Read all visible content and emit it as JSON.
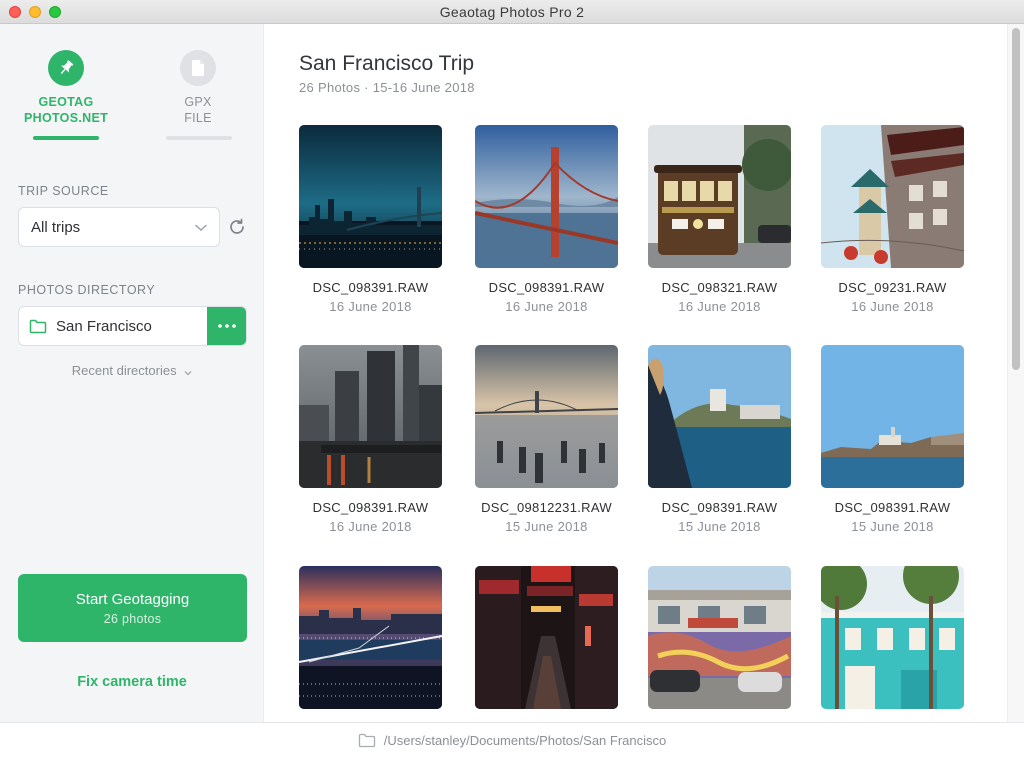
{
  "window": {
    "title": "Geaotag Photos Pro 2"
  },
  "sidebar": {
    "tabs": [
      {
        "label": "GEOTAG\nPHOTOS.NET",
        "icon": "pushpin-icon",
        "active": true
      },
      {
        "label": "GPX\nFILE",
        "icon": "file-icon",
        "active": false
      }
    ],
    "trip_source": {
      "label": "TRIP SOURCE",
      "value": "All trips"
    },
    "photos_directory": {
      "label": "PHOTOS DIRECTORY",
      "value": "San Francisco"
    },
    "recent_directories": "Recent directories",
    "start_button": {
      "title": "Start Geotagging",
      "subtitle": "26 photos"
    },
    "fix_camera_time": "Fix camera time"
  },
  "album": {
    "title": "San Francisco Trip",
    "meta": "26 Photos · 15-16 June 2018",
    "photos": [
      {
        "name": "DSC_098391.RAW",
        "date": "16 June 2018"
      },
      {
        "name": "DSC_098391.RAW",
        "date": "16 June 2018"
      },
      {
        "name": "DSC_098321.RAW",
        "date": "16 June 2018"
      },
      {
        "name": "DSC_09231.RAW",
        "date": "16 June 2018"
      },
      {
        "name": "DSC_098391.RAW",
        "date": "16 June 2018"
      },
      {
        "name": "DSC_09812231.RAW",
        "date": "15 June 2018"
      },
      {
        "name": "DSC_098391.RAW",
        "date": "15 June 2018"
      },
      {
        "name": "DSC_098391.RAW",
        "date": "15 June 2018"
      },
      {
        "name": "",
        "date": ""
      },
      {
        "name": "",
        "date": ""
      },
      {
        "name": "",
        "date": ""
      },
      {
        "name": "",
        "date": ""
      }
    ]
  },
  "statusbar": {
    "path": "/Users/stanley/Documents/Photos/San Francisco"
  },
  "colors": {
    "accent": "#2fb56a",
    "sidebar_bg": "#f4f5f7",
    "muted_text": "#8b9096"
  }
}
